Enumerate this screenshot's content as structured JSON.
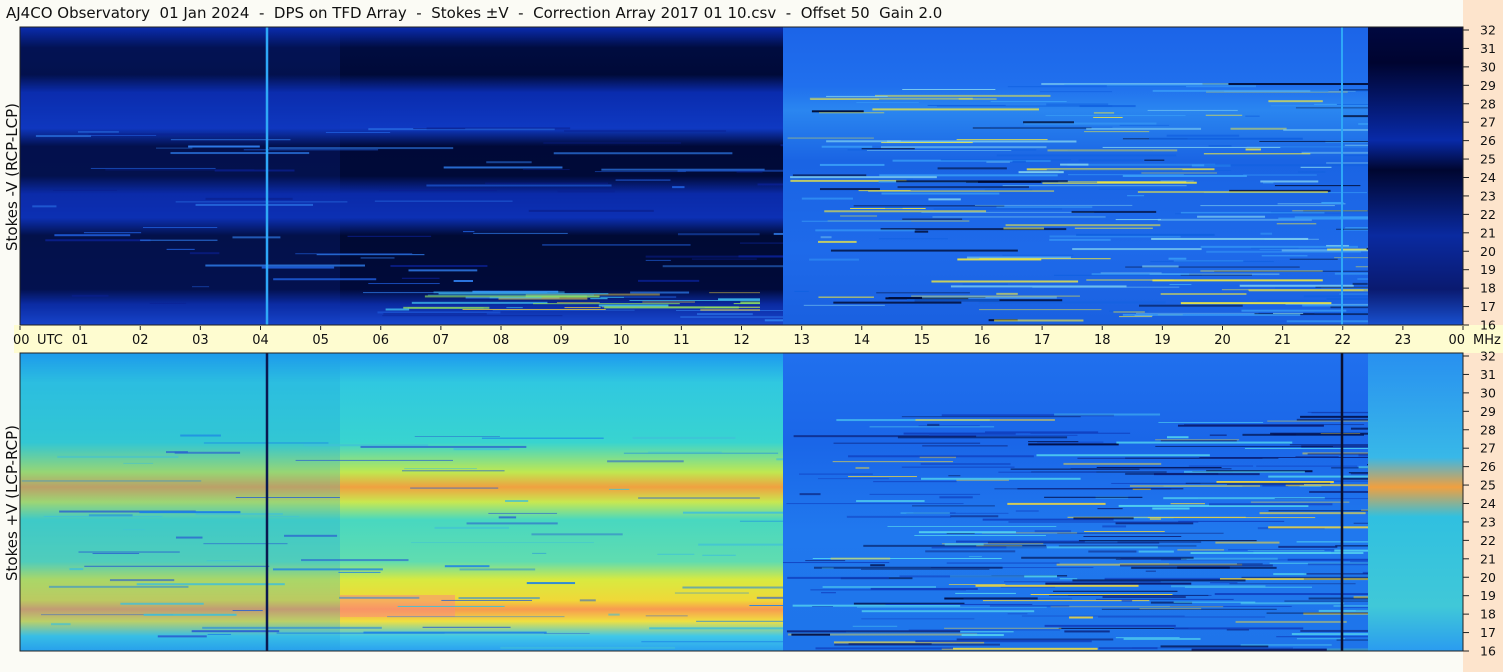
{
  "title": "AJ4CO Observatory  01 Jan 2024  -  DPS on TFD Array  -  Stokes ±V  -  Correction Array 2017 01 10.csv  -  Offset 50  Gain 2.0",
  "chart_data": {
    "type": "heatmap",
    "x_axis": {
      "unit_label": "UTC",
      "ticks": [
        "00",
        "01",
        "02",
        "03",
        "04",
        "05",
        "06",
        "07",
        "08",
        "09",
        "10",
        "11",
        "12",
        "13",
        "14",
        "15",
        "16",
        "17",
        "18",
        "19",
        "20",
        "21",
        "22",
        "23",
        "00"
      ],
      "range_hours": [
        0,
        24
      ]
    },
    "y_axis": {
      "unit_label": "MHz",
      "ticks": [
        "16",
        "17",
        "18",
        "19",
        "20",
        "21",
        "22",
        "23",
        "24",
        "25",
        "26",
        "27",
        "28",
        "29",
        "30",
        "31",
        "32"
      ],
      "range_mhz": [
        16,
        32
      ]
    },
    "panels": [
      {
        "ylabel": "Stokes -V (RCP-LCP)",
        "dominant_colors": [
          "#000a3a",
          "#0a2aa0",
          "#1a6ce8"
        ],
        "bright_vertical_lines_utc": [
          4.1,
          22.0
        ]
      },
      {
        "ylabel": "Stokes +V (LCP-RCP)",
        "dominant_colors": [
          "#30d0d0",
          "#f0ea30",
          "#f08050"
        ],
        "dark_vertical_lines_utc": [
          4.1,
          22.0
        ]
      }
    ],
    "grid": false
  }
}
